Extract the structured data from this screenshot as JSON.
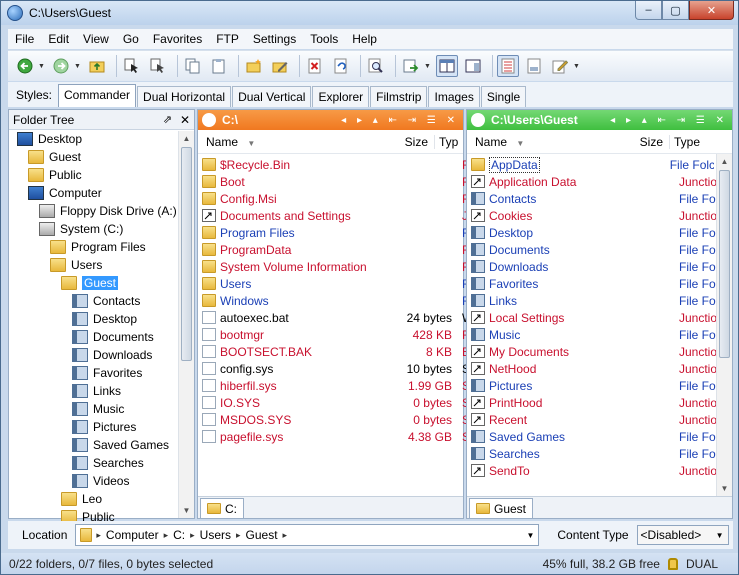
{
  "window": {
    "title": "C:\\Users\\Guest",
    "min": "–",
    "max": "▢",
    "close": "✕"
  },
  "menu": [
    "File",
    "Edit",
    "View",
    "Go",
    "Favorites",
    "FTP",
    "Settings",
    "Tools",
    "Help"
  ],
  "styles": {
    "label": "Styles:",
    "tabs": [
      "Commander",
      "Dual Horizontal",
      "Dual Vertical",
      "Explorer",
      "Filmstrip",
      "Images",
      "Single"
    ],
    "active": "Commander"
  },
  "tree": {
    "header": "Folder Tree",
    "items": [
      {
        "label": "Desktop",
        "icon": "desktop-icon",
        "level": 0
      },
      {
        "label": "Guest",
        "icon": "user-folder-icon",
        "level": 1
      },
      {
        "label": "Public",
        "icon": "folder-icon",
        "level": 1
      },
      {
        "label": "Computer",
        "icon": "computer-icon",
        "level": 1
      },
      {
        "label": "Floppy Disk Drive (A:)",
        "icon": "floppy-icon",
        "level": 2
      },
      {
        "label": "System (C:)",
        "icon": "drive-icon",
        "level": 2
      },
      {
        "label": "Program Files",
        "icon": "folder-icon",
        "level": 3
      },
      {
        "label": "Users",
        "icon": "folder-icon",
        "level": 3
      },
      {
        "label": "Guest",
        "icon": "folder-icon",
        "level": 4,
        "selected": true
      },
      {
        "label": "Contacts",
        "icon": "special-folder-icon",
        "level": 5
      },
      {
        "label": "Desktop",
        "icon": "special-folder-icon",
        "level": 5
      },
      {
        "label": "Documents",
        "icon": "special-folder-icon",
        "level": 5
      },
      {
        "label": "Downloads",
        "icon": "special-folder-icon",
        "level": 5
      },
      {
        "label": "Favorites",
        "icon": "special-folder-icon",
        "level": 5
      },
      {
        "label": "Links",
        "icon": "special-folder-icon",
        "level": 5
      },
      {
        "label": "Music",
        "icon": "special-folder-icon",
        "level": 5
      },
      {
        "label": "Pictures",
        "icon": "special-folder-icon",
        "level": 5
      },
      {
        "label": "Saved Games",
        "icon": "special-folder-icon",
        "level": 5
      },
      {
        "label": "Searches",
        "icon": "special-folder-icon",
        "level": 5
      },
      {
        "label": "Videos",
        "icon": "special-folder-icon",
        "level": 5
      },
      {
        "label": "Leo",
        "icon": "folder-icon",
        "level": 4
      },
      {
        "label": "Public",
        "icon": "folder-icon",
        "level": 4
      }
    ]
  },
  "left_pane": {
    "path": "C:\\",
    "accent": "#f07820",
    "cols": {
      "name": "Name",
      "size": "Size",
      "type": "Typ"
    },
    "rows": [
      {
        "name": "$Recycle.Bin",
        "size": "",
        "type": "File",
        "color": "red",
        "icon": "folder"
      },
      {
        "name": "Boot",
        "size": "",
        "type": "File",
        "color": "red",
        "icon": "folder"
      },
      {
        "name": "Config.Msi",
        "size": "",
        "type": "File",
        "color": "red",
        "icon": "folder"
      },
      {
        "name": "Documents and Settings",
        "size": "",
        "type": "Jun",
        "color": "red",
        "icon": "shortcut"
      },
      {
        "name": "Program Files",
        "size": "",
        "type": "File",
        "color": "blue",
        "icon": "folder"
      },
      {
        "name": "ProgramData",
        "size": "",
        "type": "File",
        "color": "red",
        "icon": "folder"
      },
      {
        "name": "System Volume Information",
        "size": "",
        "type": "File",
        "color": "red",
        "icon": "folder"
      },
      {
        "name": "Users",
        "size": "",
        "type": "File",
        "color": "blue",
        "icon": "folder"
      },
      {
        "name": "Windows",
        "size": "",
        "type": "File",
        "color": "blue",
        "icon": "folder"
      },
      {
        "name": "autoexec.bat",
        "size": "24 bytes",
        "type": "Win",
        "color": "blk",
        "icon": "doc"
      },
      {
        "name": "bootmgr",
        "size": "428 KB",
        "type": "File",
        "color": "red",
        "icon": "doc"
      },
      {
        "name": "BOOTSECT.BAK",
        "size": "8 KB",
        "type": "BAK",
        "color": "red",
        "icon": "doc"
      },
      {
        "name": "config.sys",
        "size": "10 bytes",
        "type": "Syst",
        "color": "blk",
        "icon": "doc"
      },
      {
        "name": "hiberfil.sys",
        "size": "1.99 GB",
        "type": "Syst",
        "color": "red",
        "icon": "doc"
      },
      {
        "name": "IO.SYS",
        "size": "0 bytes",
        "type": "Syst",
        "color": "red",
        "icon": "doc"
      },
      {
        "name": "MSDOS.SYS",
        "size": "0 bytes",
        "type": "Syst",
        "color": "red",
        "icon": "doc"
      },
      {
        "name": "pagefile.sys",
        "size": "4.38 GB",
        "type": "Syst",
        "color": "red",
        "icon": "doc"
      }
    ],
    "tab": "C:"
  },
  "right_pane": {
    "path": "C:\\Users\\Guest",
    "accent": "#3fbf3f",
    "cols": {
      "name": "Name",
      "size": "Size",
      "type": "Type"
    },
    "rows": [
      {
        "name": "AppData",
        "type": "File Folc",
        "color": "blue",
        "icon": "folder",
        "sel": true
      },
      {
        "name": "Application Data",
        "type": "Junction",
        "color": "red",
        "icon": "shortcut"
      },
      {
        "name": "Contacts",
        "type": "File Folc",
        "color": "blue",
        "icon": "special"
      },
      {
        "name": "Cookies",
        "type": "Junction",
        "color": "red",
        "icon": "shortcut"
      },
      {
        "name": "Desktop",
        "type": "File Folc",
        "color": "blue",
        "icon": "special"
      },
      {
        "name": "Documents",
        "type": "File Folc",
        "color": "blue",
        "icon": "special"
      },
      {
        "name": "Downloads",
        "type": "File Folc",
        "color": "blue",
        "icon": "special"
      },
      {
        "name": "Favorites",
        "type": "File Folc",
        "color": "blue",
        "icon": "special"
      },
      {
        "name": "Links",
        "type": "File Folc",
        "color": "blue",
        "icon": "special"
      },
      {
        "name": "Local Settings",
        "type": "Junction",
        "color": "red",
        "icon": "shortcut"
      },
      {
        "name": "Music",
        "type": "File Folc",
        "color": "blue",
        "icon": "special"
      },
      {
        "name": "My Documents",
        "type": "Junction",
        "color": "red",
        "icon": "shortcut"
      },
      {
        "name": "NetHood",
        "type": "Junction",
        "color": "red",
        "icon": "shortcut"
      },
      {
        "name": "Pictures",
        "type": "File Folc",
        "color": "blue",
        "icon": "special"
      },
      {
        "name": "PrintHood",
        "type": "Junction",
        "color": "red",
        "icon": "shortcut"
      },
      {
        "name": "Recent",
        "type": "Junction",
        "color": "red",
        "icon": "shortcut"
      },
      {
        "name": "Saved Games",
        "type": "File Folc",
        "color": "blue",
        "icon": "special"
      },
      {
        "name": "Searches",
        "type": "File Folc",
        "color": "blue",
        "icon": "special"
      },
      {
        "name": "SendTo",
        "type": "Junction",
        "color": "red",
        "icon": "shortcut"
      }
    ],
    "tab": "Guest"
  },
  "location": {
    "label": "Location",
    "crumbs": [
      "Computer",
      "C:",
      "Users",
      "Guest"
    ]
  },
  "content_type": {
    "label": "Content Type",
    "value": "<Disabled>"
  },
  "status": {
    "left": "0/22 folders, 0/7 files, 0 bytes selected",
    "right": "45% full, 38.2 GB free",
    "mode": "DUAL"
  }
}
